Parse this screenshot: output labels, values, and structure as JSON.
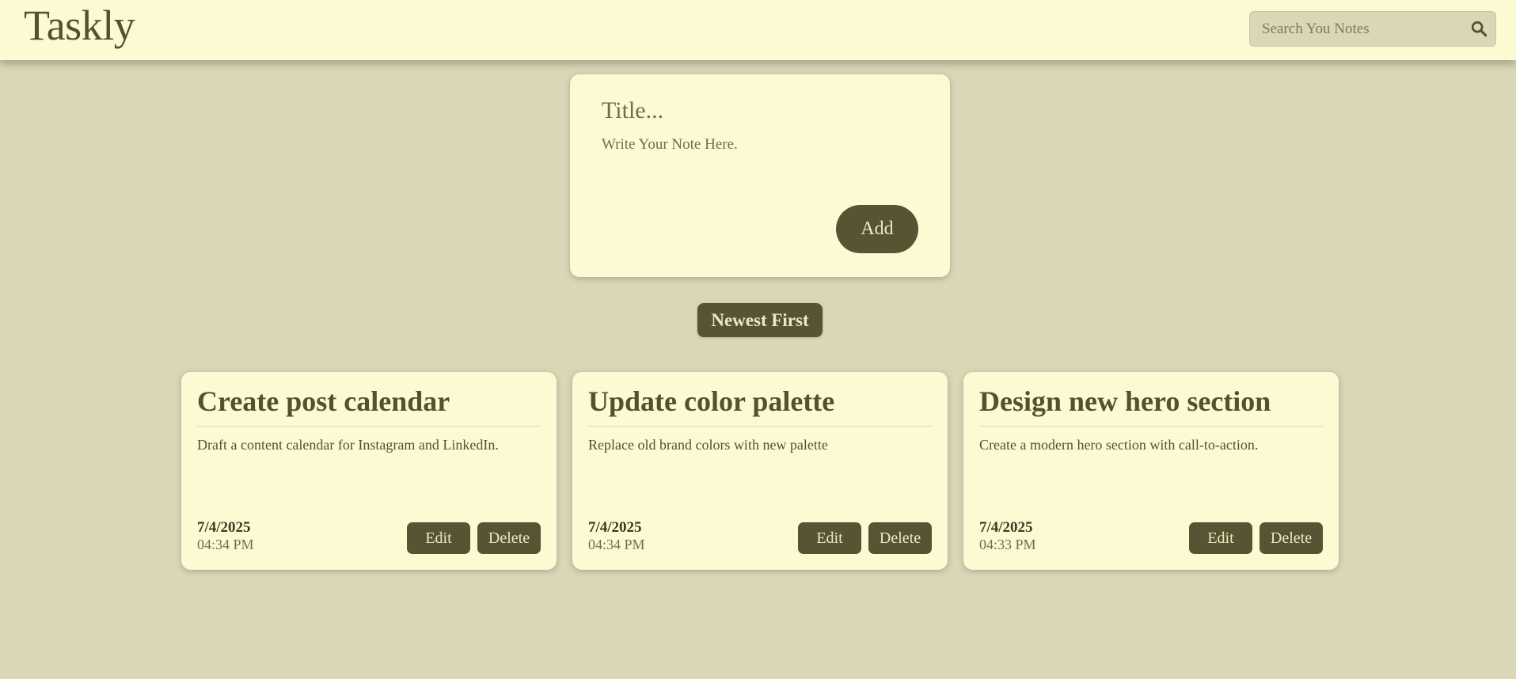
{
  "header": {
    "logo": "Taskly",
    "search": {
      "placeholder": "Search You Notes",
      "value": "",
      "icon": "search-icon"
    }
  },
  "composer": {
    "title_placeholder": "Title...",
    "body_placeholder": "Write Your Note Here.",
    "add_label": "Add"
  },
  "sort": {
    "label": "Newest First"
  },
  "notes": [
    {
      "title": "Create post calendar",
      "body": "Draft a content calendar for Instagram and LinkedIn.",
      "date": "7/4/2025",
      "time": "04:34 PM",
      "edit_label": "Edit",
      "delete_label": "Delete"
    },
    {
      "title": "Update color palette",
      "body": "Replace old brand colors with new palette",
      "date": "7/4/2025",
      "time": "04:34 PM",
      "edit_label": "Edit",
      "delete_label": "Delete"
    },
    {
      "title": "Design new hero section",
      "body": "Create a modern hero section with call-to-action.",
      "date": "7/4/2025",
      "time": "04:33 PM",
      "edit_label": "Edit",
      "delete_label": "Delete"
    }
  ],
  "colors": {
    "background": "#d9d7b6",
    "surface": "#fcfad2",
    "accent": "#575433",
    "accent_text": "#ece8bf",
    "text": "#55512f"
  }
}
